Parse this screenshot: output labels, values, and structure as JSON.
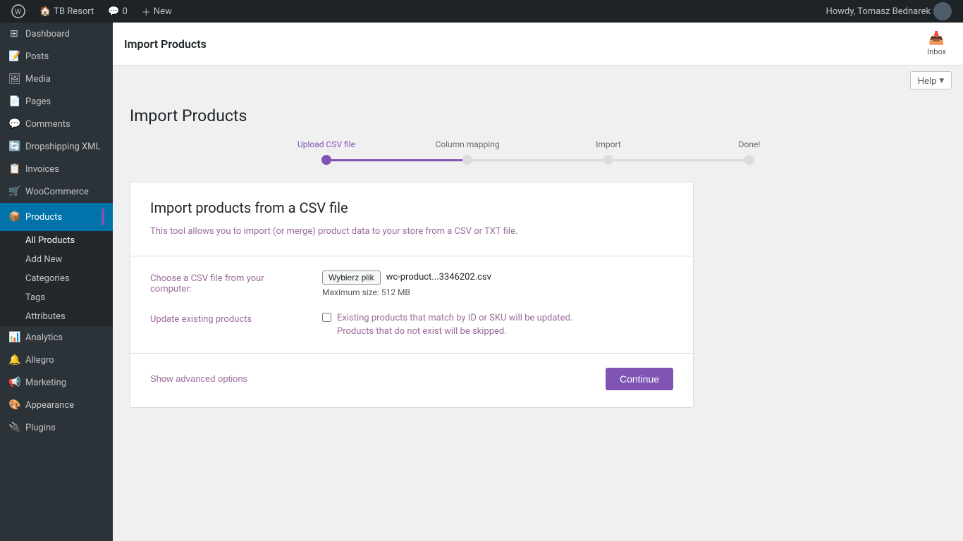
{
  "adminbar": {
    "site_name": "TB Resort",
    "new_label": "New",
    "notifications": "0",
    "user_greeting": "Howdy, Tomasz Bednarek"
  },
  "sidebar": {
    "items": [
      {
        "id": "dashboard",
        "label": "Dashboard",
        "icon": "⊞"
      },
      {
        "id": "posts",
        "label": "Posts",
        "icon": "📝"
      },
      {
        "id": "media",
        "label": "Media",
        "icon": "🖼"
      },
      {
        "id": "pages",
        "label": "Pages",
        "icon": "📄"
      },
      {
        "id": "comments",
        "label": "Comments",
        "icon": "💬"
      },
      {
        "id": "dropshipping",
        "label": "Dropshipping XML",
        "icon": "🔄"
      },
      {
        "id": "invoices",
        "label": "Invoices",
        "icon": "📋"
      },
      {
        "id": "woocommerce",
        "label": "WooCommerce",
        "icon": "🛒"
      },
      {
        "id": "products",
        "label": "Products",
        "icon": "📦",
        "active": true
      },
      {
        "id": "analytics",
        "label": "Analytics",
        "icon": "📊"
      },
      {
        "id": "allegro",
        "label": "Allegro",
        "icon": "🔔"
      },
      {
        "id": "marketing",
        "label": "Marketing",
        "icon": "📢"
      },
      {
        "id": "appearance",
        "label": "Appearance",
        "icon": "🎨"
      },
      {
        "id": "plugins",
        "label": "Plugins",
        "icon": "🔌"
      }
    ],
    "submenu": [
      {
        "id": "all-products",
        "label": "All Products"
      },
      {
        "id": "add-new",
        "label": "Add New"
      },
      {
        "id": "categories",
        "label": "Categories"
      },
      {
        "id": "tags",
        "label": "Tags"
      },
      {
        "id": "attributes",
        "label": "Attributes"
      }
    ]
  },
  "header": {
    "title": "Import Products",
    "inbox_label": "Inbox",
    "help_label": "Help"
  },
  "page": {
    "title": "Import Products"
  },
  "steps": [
    {
      "id": "upload-csv",
      "label": "Upload CSV file",
      "active": true
    },
    {
      "id": "column-mapping",
      "label": "Column mapping",
      "active": false
    },
    {
      "id": "import",
      "label": "Import",
      "active": false
    },
    {
      "id": "done",
      "label": "Done!",
      "active": false
    }
  ],
  "import_card": {
    "title": "Import products from a CSV file",
    "description": "This tool allows you to import (or merge) product data to your store from a CSV or TXT file.",
    "file_label": "Choose a CSV file from your computer:",
    "file_button": "Wybierz plik",
    "file_name": "wc-product...3346202.csv",
    "max_size_label": "Maximum size: 512 MB",
    "update_label": "Update existing products",
    "update_checkbox_desc_1": "Existing products that match by ID or SKU will be updated.",
    "update_checkbox_desc_2": "Products that do not exist will be skipped.",
    "show_advanced": "Show advanced options",
    "continue_btn": "Continue"
  }
}
